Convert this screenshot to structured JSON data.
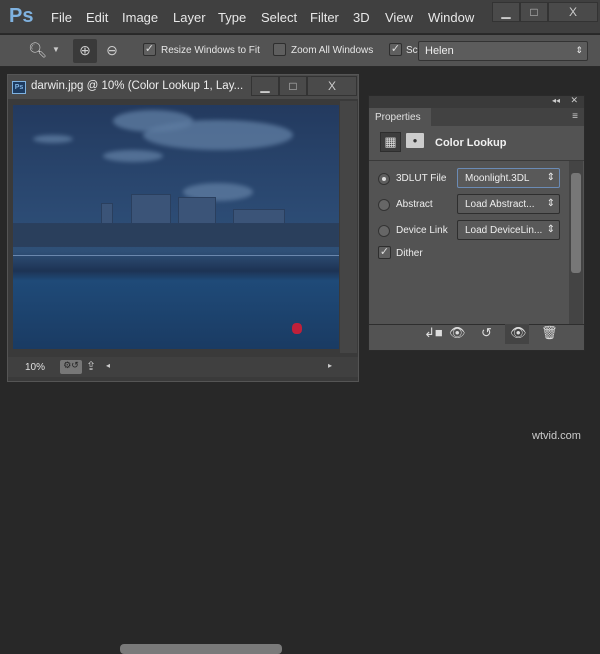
{
  "app": {
    "logo": "Ps"
  },
  "menu": [
    "File",
    "Edit",
    "Image",
    "Layer",
    "Type",
    "Select",
    "Filter",
    "3D",
    "View",
    "Window"
  ],
  "window_controls": {
    "minimize": "▁",
    "maximize": "□",
    "close": "X"
  },
  "options": {
    "resize_windows": {
      "label": "Resize Windows to Fit",
      "checked": true
    },
    "zoom_all": {
      "label": "Zoom All Windows",
      "checked": false
    },
    "scrubby": {
      "label": "Sc",
      "checked": true
    },
    "font_select": "Helen"
  },
  "document": {
    "title": "darwin.jpg @ 10% (Color Lookup 1, Lay...",
    "zoom": "10%"
  },
  "properties": {
    "tab": "Properties",
    "header": "Color Lookup",
    "rows": [
      {
        "label": "3DLUT File",
        "value": "Moonlight.3DL",
        "selected": true
      },
      {
        "label": "Abstract",
        "value": "Load Abstract...",
        "selected": false
      },
      {
        "label": "Device Link",
        "value": "Load DeviceLin...",
        "selected": false
      }
    ],
    "dither": {
      "label": "Dither",
      "checked": true
    }
  },
  "watermark": "wtvid.com"
}
